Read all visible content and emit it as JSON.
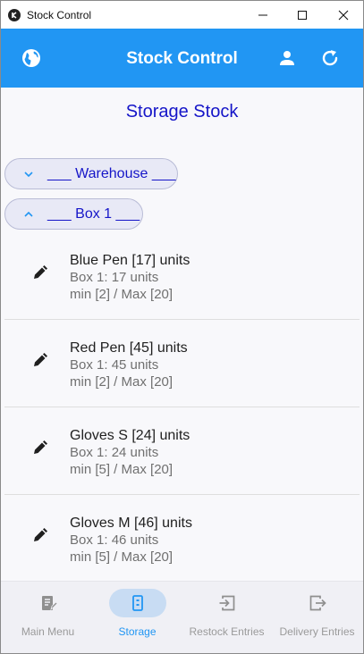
{
  "window": {
    "title": "Stock Control"
  },
  "appbar": {
    "title": "Stock Control"
  },
  "content": {
    "section_title": "Storage Stock",
    "groups": {
      "warehouse": "___ Warehouse ___",
      "box": "___ Box 1 ___"
    },
    "items": [
      {
        "title": "Blue Pen [17] units",
        "location": "Box 1: 17 units",
        "limits": "min [2] / Max [20]"
      },
      {
        "title": "Red Pen [45] units",
        "location": "Box 1: 45 units",
        "limits": "min [2] / Max [20]"
      },
      {
        "title": "Gloves S [24] units",
        "location": "Box 1: 24 units",
        "limits": "min [5] / Max [20]"
      },
      {
        "title": "Gloves M [46] units",
        "location": "Box 1: 46 units",
        "limits": "min [5] / Max [20]"
      }
    ]
  },
  "nav": {
    "items": [
      {
        "label": "Main Menu",
        "icon": "inventory-icon",
        "active": false
      },
      {
        "label": "Storage",
        "icon": "storage-icon",
        "active": true
      },
      {
        "label": "Restock Entries",
        "icon": "restock-icon",
        "active": false
      },
      {
        "label": "Delivery Entries",
        "icon": "delivery-icon",
        "active": false
      }
    ]
  },
  "colors": {
    "primary": "#2196f3",
    "accent_text": "#1515c8",
    "chip_bg": "#e8e9f6",
    "nav_active_bg": "#c8dcf3"
  }
}
